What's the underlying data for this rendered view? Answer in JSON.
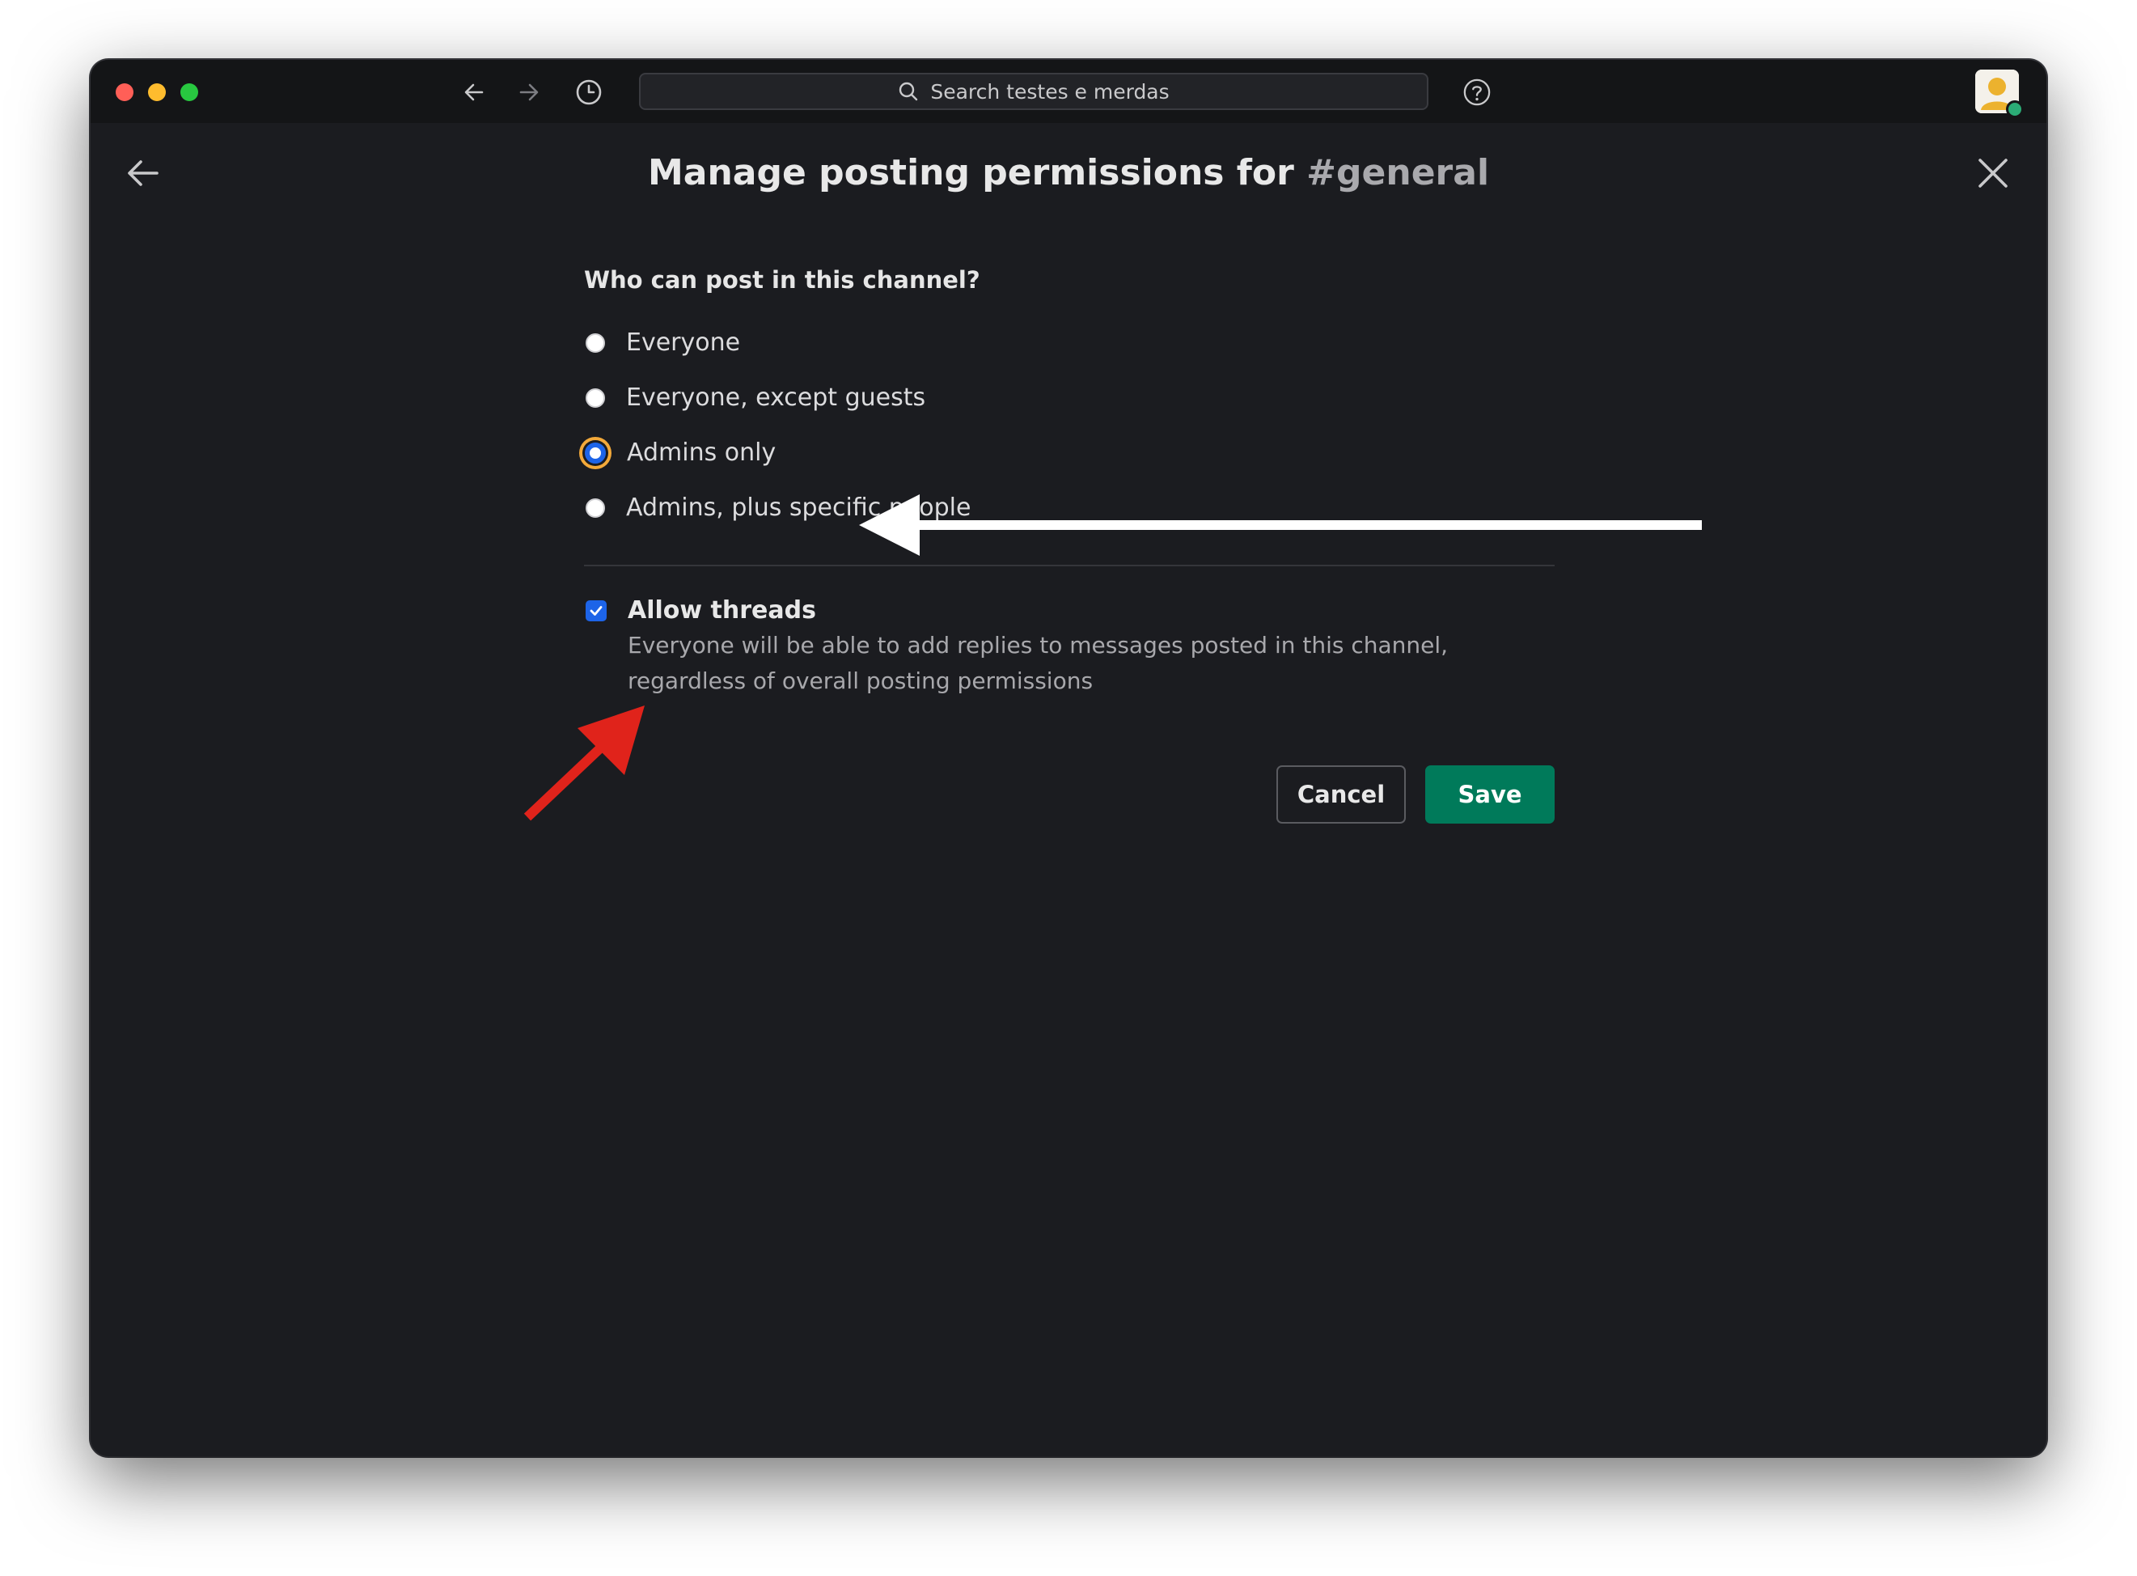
{
  "window": {
    "traffic_colors": {
      "close": "#ff5f57",
      "minimize": "#febc2e",
      "zoom": "#28c840"
    }
  },
  "toolbar": {
    "back_icon": "arrow-left-icon",
    "forward_icon": "arrow-right-icon",
    "history_icon": "clock-icon",
    "search_placeholder": "Search testes e merdas",
    "help_icon": "question-circle-icon"
  },
  "modal": {
    "title_prefix": "Manage posting permissions for",
    "channel_hash": "#",
    "channel_name": "general",
    "question": "Who can post in this channel?",
    "options": [
      {
        "label": "Everyone",
        "selected": false
      },
      {
        "label": "Everyone, except guests",
        "selected": false
      },
      {
        "label": "Admins only",
        "selected": true
      },
      {
        "label": "Admins, plus specific people",
        "selected": false
      }
    ],
    "threads": {
      "checked": true,
      "title": "Allow threads",
      "description": "Everyone will be able to add replies to messages posted in this channel, regardless of overall posting permissions"
    },
    "cancel_label": "Cancel",
    "save_label": "Save"
  },
  "colors": {
    "background": "#1b1c20",
    "accent_blue": "#1d64e8",
    "save_green": "#007a5a",
    "focus_ring": "#f3a93a",
    "annotation_red": "#e0231b",
    "annotation_white": "#ffffff"
  }
}
